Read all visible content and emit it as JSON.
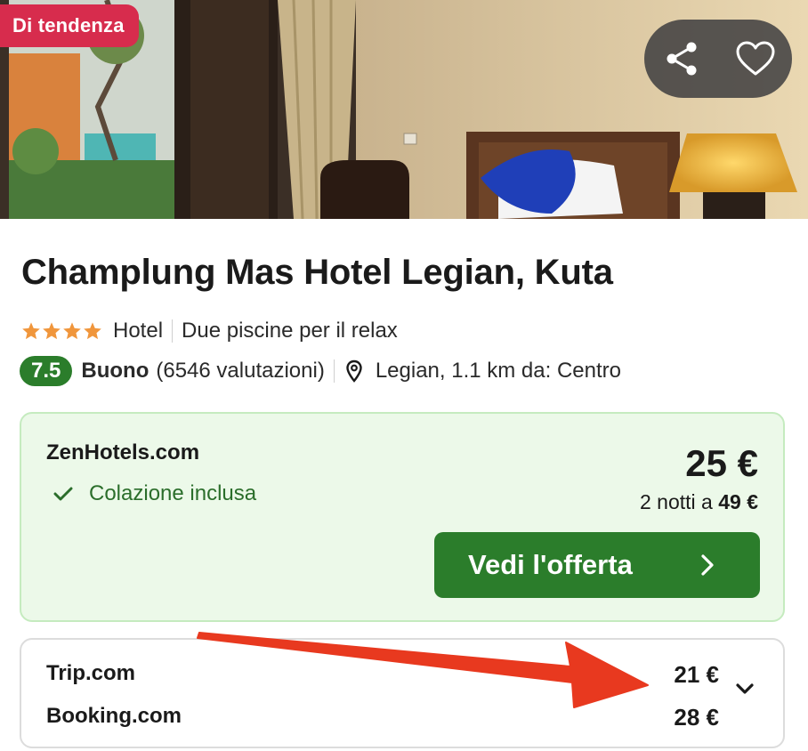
{
  "photo": {
    "badge": "Di tendenza",
    "actions": {
      "share_icon": "share-icon",
      "favorite_icon": "heart-icon"
    }
  },
  "hotel": {
    "name": "Champlung Mas Hotel Legian, Kuta",
    "stars": 4,
    "type": "Hotel",
    "highlight": "Due piscine per il relax",
    "score": "7.5",
    "rating_word": "Buono",
    "reviews": "(6546 valutazioni)",
    "location": "Legian, 1.1 km da: Centro"
  },
  "main_offer": {
    "provider": "ZenHotels.com",
    "perk": "Colazione inclusa",
    "price": "25 €",
    "nights_prefix": "2 notti a ",
    "nights_total": "49 €",
    "cta_label": "Vedi l'offerta"
  },
  "other_offers": [
    {
      "provider": "Trip.com",
      "price": "21 €"
    },
    {
      "provider": "Booking.com",
      "price": "28 €"
    }
  ],
  "colors": {
    "badge": "#d72c4d",
    "accent_green": "#2b7d2b",
    "offer_bg": "#ecf9e9",
    "star": "#f0963c",
    "arrow": "#e8391f"
  }
}
